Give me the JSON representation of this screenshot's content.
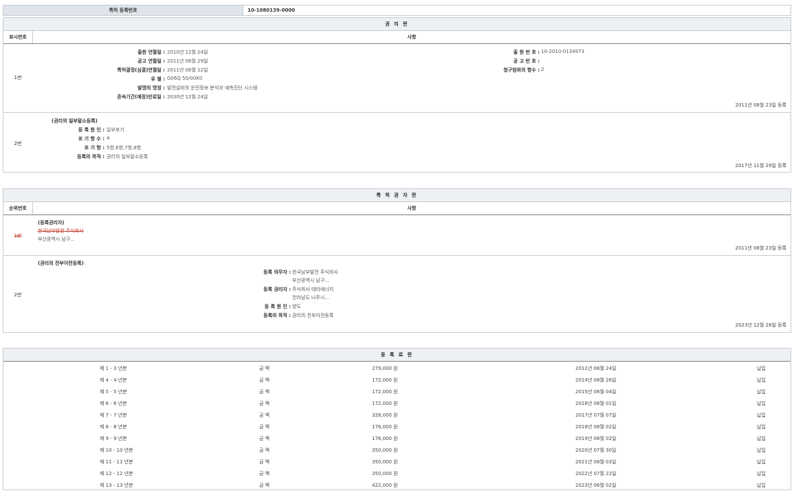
{
  "top": {
    "key": "특허 등록번호",
    "value": "10-1080139-0000"
  },
  "rights": {
    "title": "권 리 란",
    "col_num": "표시번호",
    "col_content": "사항",
    "entries": [
      {
        "num": "1번",
        "left": [
          {
            "label": "출원 연월일 :",
            "value": "2010년 12월 24일"
          },
          {
            "label": "공고 연월일 :",
            "value": "2011년 08월 29일"
          },
          {
            "label": "특허결정(심결)연월일 :",
            "value": "2011년 08월 12일"
          },
          {
            "label": "유 별 :",
            "value": "G06Q 50/00K0"
          },
          {
            "label": "발명의 명칭 :",
            "value": "발전설비의 운전정보 분석과 예측진단 시스템"
          },
          {
            "label": "존속기간(예정)만료일 :",
            "value": "2030년 12월 24일"
          }
        ],
        "right": [
          {
            "label": "출 원 번 호 :",
            "value": "10-2010-0134973"
          },
          {
            "label": "공 고 번 호 :",
            "value": ""
          },
          {
            "label": "청구범위의 항수 :",
            "value": "2"
          }
        ],
        "reg": "2011년 08월 23일 등록"
      },
      {
        "num": "2번",
        "heading": "(권리의 일부말소등록)",
        "left": [
          {
            "label": "등 록 원 인 :",
            "value": "일부포기"
          },
          {
            "label": "포 기 항 수 :",
            "value": "4"
          },
          {
            "label": "포 기 항 :",
            "value": "5항,6항,7항,8항"
          },
          {
            "label": "등록의 목적 :",
            "value": "권리의 일부말소등록"
          }
        ],
        "reg": "2017년 11월 29일 등록"
      }
    ]
  },
  "holders": {
    "title": "특 허 권 자 란",
    "col_num": "순위번호",
    "col_content": "사항",
    "entries": [
      {
        "num": "1번",
        "heading": "(등록권리자)",
        "name": "한국남부발전 주식회사",
        "addr": "부산광역시 남구...",
        "reg": "2011년 08월 23일 등록"
      },
      {
        "num": "2번",
        "heading": "(권리의 전부이전등록)",
        "items": [
          {
            "label": "등록 의무자 :",
            "value": "한국남부발전 주식회사"
          },
          {
            "label": "",
            "value": "부산광역시 남구..."
          },
          {
            "label": "등록 권리자 :",
            "value": "주식회사 테라에너지"
          },
          {
            "label": "",
            "value": "전라남도 나주시..."
          },
          {
            "label": "등 록 원 인 :",
            "value": "양도"
          },
          {
            "label": "등록의 목적 :",
            "value": "권리의 전부이전등록"
          }
        ],
        "reg": "2023년 12월 28일 등록"
      }
    ]
  },
  "fees": {
    "title": "등 록 료 란",
    "rows": [
      {
        "year": "제 1 - 3 년분",
        "label": "금 액",
        "amount": "279,000 원",
        "date": "2011년 08월 24일",
        "status": "납입"
      },
      {
        "year": "제 4 - 4 년분",
        "label": "금 액",
        "amount": "172,000 원",
        "date": "2014년 08월 26일",
        "status": "납입"
      },
      {
        "year": "제 5 - 5 년분",
        "label": "금 액",
        "amount": "172,000 원",
        "date": "2015년 08월 04일",
        "status": "납입"
      },
      {
        "year": "제 6 - 6 년분",
        "label": "금 액",
        "amount": "172,000 원",
        "date": "2016년 08월 01일",
        "status": "납입"
      },
      {
        "year": "제 7 - 7 년분",
        "label": "금 액",
        "amount": "328,000 원",
        "date": "2017년 07월 07일",
        "status": "납입"
      },
      {
        "year": "제 8 - 8 년분",
        "label": "금 액",
        "amount": "176,000 원",
        "date": "2018년 08월 02일",
        "status": "납입"
      },
      {
        "year": "제 9 - 9 년분",
        "label": "금 액",
        "amount": "176,000 원",
        "date": "2019년 08월 02일",
        "status": "납입"
      },
      {
        "year": "제 10 - 10 년분",
        "label": "금 액",
        "amount": "350,000 원",
        "date": "2020년 07월 30일",
        "status": "납입"
      },
      {
        "year": "제 11 - 11 년분",
        "label": "금 액",
        "amount": "350,000 원",
        "date": "2021년 08월 03일",
        "status": "납입"
      },
      {
        "year": "제 12 - 12 년분",
        "label": "금 액",
        "amount": "350,000 원",
        "date": "2022년 07월 22일",
        "status": "납입"
      },
      {
        "year": "제 13 - 13 년분",
        "label": "금 액",
        "amount": "422,000 원",
        "date": "2023년 06월 02일",
        "status": "납입"
      }
    ]
  }
}
